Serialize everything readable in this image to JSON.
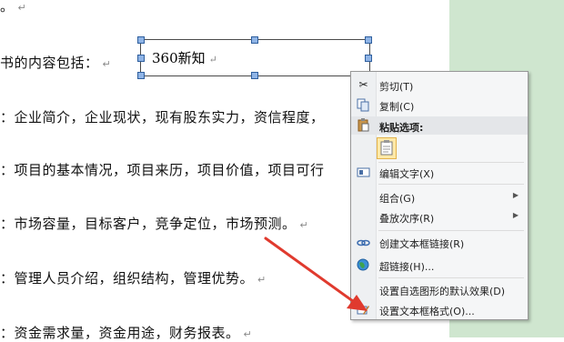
{
  "document": {
    "lines": [
      {
        "text": "。",
        "mark": "↵"
      },
      {
        "text": "书的内容包括：",
        "mark": "↵"
      },
      {
        "text": "：企业简介，企业现状，现有股东实力，资信程度，",
        "mark": ""
      },
      {
        "text": "：项目的基本情况，项目来历，项目价值，项目可行",
        "mark": ""
      },
      {
        "text": "：市场容量，目标客户，竞争定位，市场预测。",
        "mark": "↵"
      },
      {
        "text": "：管理人员介绍，组织结构，管理优势。",
        "mark": "↵"
      },
      {
        "text": "：资金需求量，资金用途，财务报表。",
        "mark": "↵"
      }
    ]
  },
  "textbox": {
    "text": "360新知",
    "mark": "↵"
  },
  "context_menu": {
    "items": [
      {
        "label": "剪切(T)",
        "icon": "scissors-icon"
      },
      {
        "label": "复制(C)",
        "icon": "copy-icon"
      },
      {
        "label": "粘贴选项:",
        "icon": "paste-icon"
      },
      {
        "label": "编辑文字(X)",
        "icon": "edit-text-icon"
      },
      {
        "label": "组合(G)",
        "icon": "",
        "submenu": true
      },
      {
        "label": "叠放次序(R)",
        "icon": "",
        "submenu": true
      },
      {
        "label": "创建文本框链接(R)",
        "icon": "link-icon"
      },
      {
        "label": "超链接(H)...",
        "icon": "hyperlink-globe-icon"
      },
      {
        "label": "设置自选图形的默认效果(D)",
        "icon": ""
      },
      {
        "label": "设置文本框格式(O)...",
        "icon": "format-textbox-icon"
      }
    ],
    "submenu_glyph": "▶"
  },
  "colors": {
    "green_margin": "#cfe6cf",
    "arrow": "#e03a2e",
    "menu_bg": "#f5f6f7"
  }
}
